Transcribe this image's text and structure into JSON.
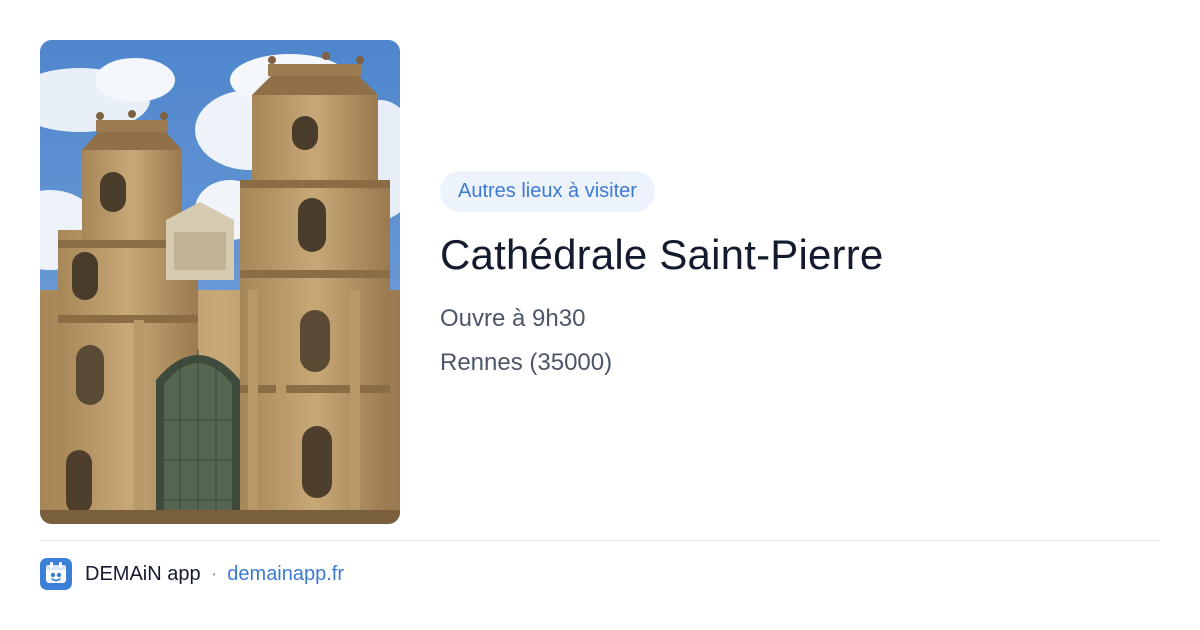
{
  "photo": {
    "subject_icon": "cathedral-photo"
  },
  "place": {
    "category_badge": "Autres lieux à visiter",
    "name": "Cathédrale Saint-Pierre",
    "opening": "Ouvre à 9h30",
    "location": "Rennes (35000)"
  },
  "footer": {
    "app_icon": "demain-app-icon",
    "app_name": "DEMAiN app",
    "separator": "·",
    "website": "demainapp.fr"
  },
  "colors": {
    "accent": "#3d7ad2",
    "badge_bg": "#edf3fc",
    "title": "#141b2e",
    "secondary_text": "#4d5669"
  }
}
